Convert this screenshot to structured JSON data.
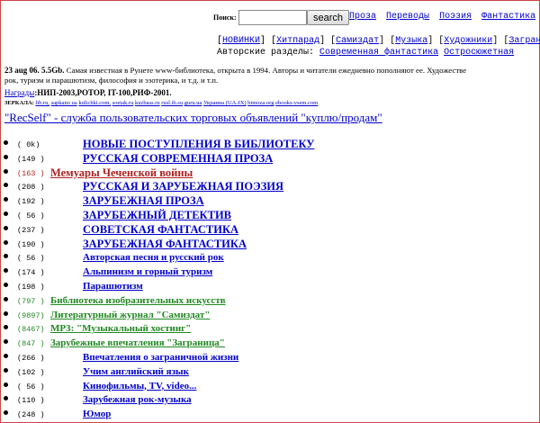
{
  "search": {
    "label": "Поиск:",
    "button": "search",
    "input_value": ""
  },
  "top_links": [
    "Проза",
    "Переводы",
    "Поэзия",
    "Фантастика"
  ],
  "menu": {
    "items": [
      "НОВИНКИ",
      "Хитпарад",
      "Самиздат",
      "Музыка",
      "Художники",
      "Заграни"
    ],
    "authors_label": "Авторские разделы:",
    "author_links": [
      "Современная фантастика",
      "Остросюжетная"
    ]
  },
  "intro": {
    "date": "23 aug 06. 5.5Gb.",
    "text": "Самая известная в Рунете www-библиотека, открыта в 1994. Авторы и читатели ежедневно пополняют ее. Художестве",
    "text2": "рок, туризм и парашютизм, философия и эзотерика, и т.д. и т.п.",
    "awards_label": "Награды",
    "awards_text": ":НИП-2003,РОТОР, IT-100,РИФ-2001.",
    "mirrors_label": "ЗЕРКАЛА:",
    "mirrors": [
      "lib.ru,",
      "sapkano ua",
      "kulichki.com,",
      "soetak.ru",
      "kuzbass.ru",
      "rusl.ib.su",
      "guru.ua",
      "Украина (UA-IX)",
      "bimoza.org",
      "ebooks-vsem.com"
    ],
    "recself": "\"RecSelf\" - служба пользовательских торговых объявлений \"куплю/продам\""
  },
  "catalog": [
    {
      "count": "(   0k)",
      "title": "НОВЫЕ ПОСТУПЛЕНИЯ В БИБЛИОТЕКУ",
      "style": "big",
      "indent": 88
    },
    {
      "count": "(149 )",
      "title": "РУССКАЯ СОВРЕМЕННАЯ ПРОЗА",
      "style": "big",
      "indent": 88
    },
    {
      "count": "(163 )",
      "title": "Мемуары Чеченской войны",
      "style": "big red",
      "indent": 52
    },
    {
      "count": "(208 )",
      "title": "РУССКАЯ И ЗАРУБЕЖНАЯ ПОЭЗИЯ",
      "style": "big",
      "indent": 88
    },
    {
      "count": "(192 )",
      "title": "ЗАРУБЕЖНАЯ ПРОЗА",
      "style": "big",
      "indent": 88
    },
    {
      "count": "( 56 )",
      "title": "ЗАРУБЕЖНЫЙ ДЕТЕКТИВ",
      "style": "big",
      "indent": 88
    },
    {
      "count": "(237 )",
      "title": "СОВЕТСКАЯ ФАНТАСТИКА",
      "style": "big",
      "indent": 88
    },
    {
      "count": "(190 )",
      "title": "ЗАРУБЕЖНАЯ ФАНТАСТИКА",
      "style": "big",
      "indent": 88
    },
    {
      "count": "( 56 )",
      "title": "Авторская песня и русский рок",
      "style": "small",
      "indent": 88
    },
    {
      "count": "(174 )",
      "title": "Альпинизм и горный туризм",
      "style": "small",
      "indent": 88
    },
    {
      "count": "(198 )",
      "title": "Парашютизм",
      "style": "small",
      "indent": 88
    },
    {
      "count": "(797 )",
      "title": "Библиотека изобразительных искусств",
      "style": "small green",
      "indent": 52
    },
    {
      "count": "(9897)",
      "title": "Литературный журнал \"Самиздат\"",
      "style": "small green",
      "indent": 52
    },
    {
      "count": "(8467)",
      "title": "MP3: \"Музыкальный хостинг\"",
      "style": "small green",
      "indent": 52
    },
    {
      "count": "(847 )",
      "title": "Зарубежные впечатления \"Заграница\"",
      "style": "small green",
      "indent": 52
    },
    {
      "count": "(266 )",
      "title": "Впечатления о заграничной жизни",
      "style": "small",
      "indent": 88
    },
    {
      "count": "(102 )",
      "title": "Учим английский язык",
      "style": "small",
      "indent": 88
    },
    {
      "count": "( 56 )",
      "title": "Кинофильмы, TV, video...",
      "style": "small",
      "indent": 88
    },
    {
      "count": "(110 )",
      "title": "Зарубежная рок-музыка",
      "style": "small",
      "indent": 88
    },
    {
      "count": "(248 )",
      "title": "Юмор",
      "style": "small",
      "indent": 88
    }
  ]
}
